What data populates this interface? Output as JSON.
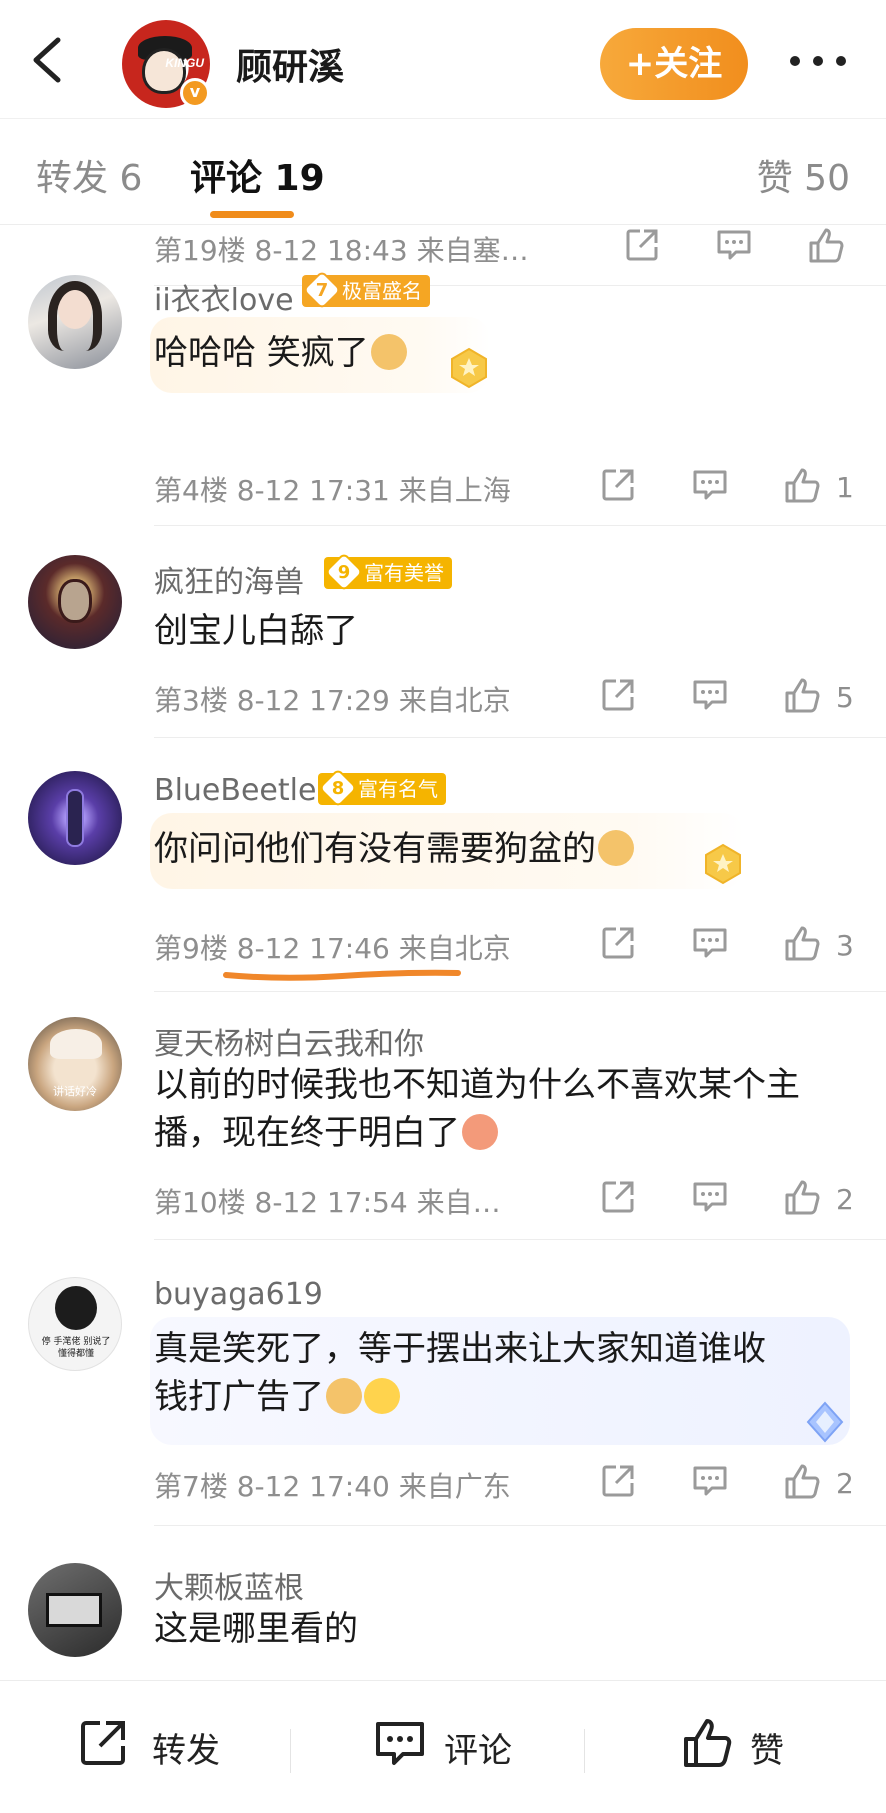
{
  "header": {
    "user_name": "顾研溪",
    "avatar_text": "KINGU",
    "follow_label": "+关注"
  },
  "tabs": {
    "repost": "转发 6",
    "comment": "评论 19",
    "like": "赞 50"
  },
  "top_partial": {
    "meta": "第19楼 8-12 18:43 来自塞…"
  },
  "comments": [
    {
      "name": "ii衣衣love",
      "badge_level": "7",
      "badge_label": "极富盛名",
      "badge_color": "#f5a623",
      "text": "哈哈哈 笑疯了",
      "meta": "第4楼 8-12 17:31 来自上海",
      "likes": "1"
    },
    {
      "name": "疯狂的海兽",
      "badge_level": "9",
      "badge_label": "富有美誉",
      "badge_color": "#f5b400",
      "text": "创宝儿白舔了",
      "meta": "第3楼 8-12 17:29 来自北京",
      "likes": "5"
    },
    {
      "name": "BlueBeetle",
      "badge_level": "8",
      "badge_label": "富有名气",
      "badge_color": "#f5b400",
      "text": "你问问他们有没有需要狗盆的",
      "meta": "第9楼 8-12 17:46 来自北京",
      "likes": "3"
    },
    {
      "name": "夏天杨树白云我和你",
      "avatar_text": "讲话好冷",
      "text_line1": "以前的时候我也不知道为什么不喜欢某个主",
      "text_line2": "播，现在终于明白了",
      "meta": "第10楼 8-12 17:54 来自…",
      "likes": "2"
    },
    {
      "name": "buyaga619",
      "avatar_text_1": "停 手滗佬 别说了",
      "avatar_text_2": "懂得都懂",
      "text_line1": "真是笑死了，等于摆出来让大家知道谁收",
      "text_line2": "钱打广告了",
      "meta": "第7楼 8-12 17:40 来自广东",
      "likes": "2"
    },
    {
      "name": "大颗板蓝根",
      "text": "这是哪里看的"
    }
  ],
  "bottom_bar": {
    "repost": "转发",
    "comment": "评论",
    "like": "赞"
  },
  "colors": {
    "accent_orange": "#f08c1b",
    "meta_gray": "#8e8e8e"
  }
}
